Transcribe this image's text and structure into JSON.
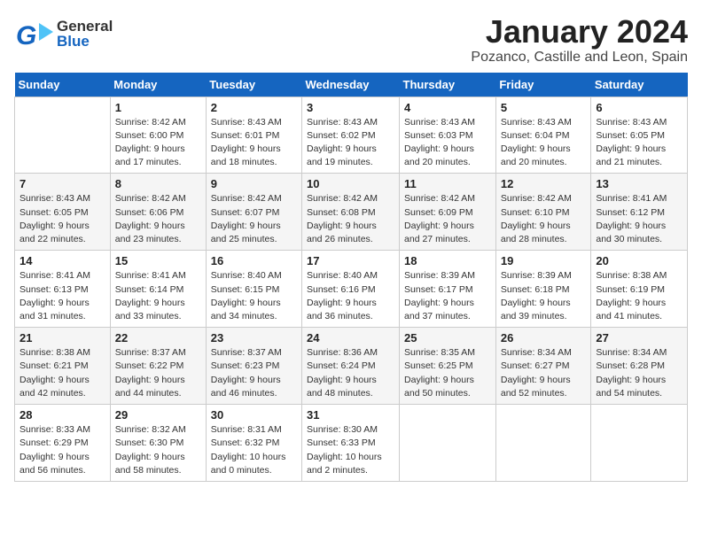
{
  "header": {
    "logo_general": "General",
    "logo_blue": "Blue",
    "month": "January 2024",
    "location": "Pozanco, Castille and Leon, Spain"
  },
  "days_of_week": [
    "Sunday",
    "Monday",
    "Tuesday",
    "Wednesday",
    "Thursday",
    "Friday",
    "Saturday"
  ],
  "weeks": [
    [
      {
        "day": "",
        "info": ""
      },
      {
        "day": "1",
        "info": "Sunrise: 8:42 AM\nSunset: 6:00 PM\nDaylight: 9 hours\nand 17 minutes."
      },
      {
        "day": "2",
        "info": "Sunrise: 8:43 AM\nSunset: 6:01 PM\nDaylight: 9 hours\nand 18 minutes."
      },
      {
        "day": "3",
        "info": "Sunrise: 8:43 AM\nSunset: 6:02 PM\nDaylight: 9 hours\nand 19 minutes."
      },
      {
        "day": "4",
        "info": "Sunrise: 8:43 AM\nSunset: 6:03 PM\nDaylight: 9 hours\nand 20 minutes."
      },
      {
        "day": "5",
        "info": "Sunrise: 8:43 AM\nSunset: 6:04 PM\nDaylight: 9 hours\nand 20 minutes."
      },
      {
        "day": "6",
        "info": "Sunrise: 8:43 AM\nSunset: 6:05 PM\nDaylight: 9 hours\nand 21 minutes."
      }
    ],
    [
      {
        "day": "7",
        "info": "Sunrise: 8:43 AM\nSunset: 6:05 PM\nDaylight: 9 hours\nand 22 minutes."
      },
      {
        "day": "8",
        "info": "Sunrise: 8:42 AM\nSunset: 6:06 PM\nDaylight: 9 hours\nand 23 minutes."
      },
      {
        "day": "9",
        "info": "Sunrise: 8:42 AM\nSunset: 6:07 PM\nDaylight: 9 hours\nand 25 minutes."
      },
      {
        "day": "10",
        "info": "Sunrise: 8:42 AM\nSunset: 6:08 PM\nDaylight: 9 hours\nand 26 minutes."
      },
      {
        "day": "11",
        "info": "Sunrise: 8:42 AM\nSunset: 6:09 PM\nDaylight: 9 hours\nand 27 minutes."
      },
      {
        "day": "12",
        "info": "Sunrise: 8:42 AM\nSunset: 6:10 PM\nDaylight: 9 hours\nand 28 minutes."
      },
      {
        "day": "13",
        "info": "Sunrise: 8:41 AM\nSunset: 6:12 PM\nDaylight: 9 hours\nand 30 minutes."
      }
    ],
    [
      {
        "day": "14",
        "info": "Sunrise: 8:41 AM\nSunset: 6:13 PM\nDaylight: 9 hours\nand 31 minutes."
      },
      {
        "day": "15",
        "info": "Sunrise: 8:41 AM\nSunset: 6:14 PM\nDaylight: 9 hours\nand 33 minutes."
      },
      {
        "day": "16",
        "info": "Sunrise: 8:40 AM\nSunset: 6:15 PM\nDaylight: 9 hours\nand 34 minutes."
      },
      {
        "day": "17",
        "info": "Sunrise: 8:40 AM\nSunset: 6:16 PM\nDaylight: 9 hours\nand 36 minutes."
      },
      {
        "day": "18",
        "info": "Sunrise: 8:39 AM\nSunset: 6:17 PM\nDaylight: 9 hours\nand 37 minutes."
      },
      {
        "day": "19",
        "info": "Sunrise: 8:39 AM\nSunset: 6:18 PM\nDaylight: 9 hours\nand 39 minutes."
      },
      {
        "day": "20",
        "info": "Sunrise: 8:38 AM\nSunset: 6:19 PM\nDaylight: 9 hours\nand 41 minutes."
      }
    ],
    [
      {
        "day": "21",
        "info": "Sunrise: 8:38 AM\nSunset: 6:21 PM\nDaylight: 9 hours\nand 42 minutes."
      },
      {
        "day": "22",
        "info": "Sunrise: 8:37 AM\nSunset: 6:22 PM\nDaylight: 9 hours\nand 44 minutes."
      },
      {
        "day": "23",
        "info": "Sunrise: 8:37 AM\nSunset: 6:23 PM\nDaylight: 9 hours\nand 46 minutes."
      },
      {
        "day": "24",
        "info": "Sunrise: 8:36 AM\nSunset: 6:24 PM\nDaylight: 9 hours\nand 48 minutes."
      },
      {
        "day": "25",
        "info": "Sunrise: 8:35 AM\nSunset: 6:25 PM\nDaylight: 9 hours\nand 50 minutes."
      },
      {
        "day": "26",
        "info": "Sunrise: 8:34 AM\nSunset: 6:27 PM\nDaylight: 9 hours\nand 52 minutes."
      },
      {
        "day": "27",
        "info": "Sunrise: 8:34 AM\nSunset: 6:28 PM\nDaylight: 9 hours\nand 54 minutes."
      }
    ],
    [
      {
        "day": "28",
        "info": "Sunrise: 8:33 AM\nSunset: 6:29 PM\nDaylight: 9 hours\nand 56 minutes."
      },
      {
        "day": "29",
        "info": "Sunrise: 8:32 AM\nSunset: 6:30 PM\nDaylight: 9 hours\nand 58 minutes."
      },
      {
        "day": "30",
        "info": "Sunrise: 8:31 AM\nSunset: 6:32 PM\nDaylight: 10 hours\nand 0 minutes."
      },
      {
        "day": "31",
        "info": "Sunrise: 8:30 AM\nSunset: 6:33 PM\nDaylight: 10 hours\nand 2 minutes."
      },
      {
        "day": "",
        "info": ""
      },
      {
        "day": "",
        "info": ""
      },
      {
        "day": "",
        "info": ""
      }
    ]
  ]
}
